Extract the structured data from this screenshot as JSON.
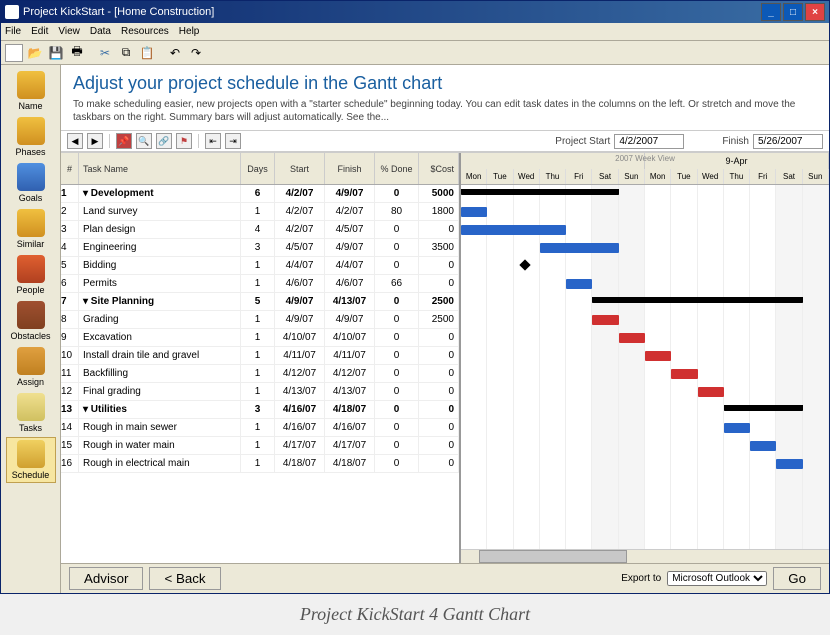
{
  "window": {
    "title": "Project KickStart - [Home Construction]"
  },
  "menu": [
    "File",
    "Edit",
    "View",
    "Data",
    "Resources",
    "Help"
  ],
  "sidebar": [
    "Name",
    "Phases",
    "Goals",
    "Similar",
    "People",
    "Obstacles",
    "Assign",
    "Tasks",
    "Schedule"
  ],
  "page": {
    "heading": "Adjust your project schedule in the Gantt chart",
    "description": "To make scheduling easier, new projects open with a \"starter schedule\" beginning today. You can edit task dates in the columns on the left. Or stretch and move the taskbars on the right. Summary bars will adjust automatically. See the..."
  },
  "gantt": {
    "start_label": "Project Start",
    "start_date": "4/2/2007",
    "finish_label": "Finish",
    "finish_date": "5/26/2007",
    "zoom": "2007 Week View"
  },
  "columns": [
    "#",
    "Task Name",
    "Days",
    "Start",
    "Finish",
    "% Done",
    "$Cost"
  ],
  "timeline": {
    "weeks": [
      "9-Apr"
    ],
    "days": [
      "Mon",
      "Tue",
      "Wed",
      "Thu",
      "Fri",
      "Sat",
      "Sun",
      "Mon",
      "Tue",
      "Wed",
      "Thu",
      "Fri",
      "Sat",
      "Sun"
    ]
  },
  "tasks": [
    {
      "id": 1,
      "name": "Development",
      "days": 6,
      "start": "4/2/07",
      "finish": "4/9/07",
      "done": 0,
      "cost": 5000,
      "summary": true,
      "indent": 0,
      "bar": [
        0,
        6
      ],
      "type": "summary"
    },
    {
      "id": 2,
      "name": "Land survey",
      "days": 1,
      "start": "4/2/07",
      "finish": "4/2/07",
      "done": 80,
      "cost": 1800,
      "indent": 1,
      "bar": [
        0,
        1
      ],
      "type": "task"
    },
    {
      "id": 3,
      "name": "Plan design",
      "days": 4,
      "start": "4/2/07",
      "finish": "4/5/07",
      "done": 0,
      "cost": 0,
      "indent": 1,
      "bar": [
        0,
        4
      ],
      "type": "task"
    },
    {
      "id": 4,
      "name": "Engineering",
      "days": 3,
      "start": "4/5/07",
      "finish": "4/9/07",
      "done": 0,
      "cost": 3500,
      "indent": 1,
      "bar": [
        3,
        3
      ],
      "type": "task"
    },
    {
      "id": 5,
      "name": "Bidding",
      "days": 1,
      "start": "4/4/07",
      "finish": "4/4/07",
      "done": 0,
      "cost": 0,
      "indent": 1,
      "bar": [
        2,
        0
      ],
      "type": "milestone"
    },
    {
      "id": 6,
      "name": "Permits",
      "days": 1,
      "start": "4/6/07",
      "finish": "4/6/07",
      "done": 66,
      "cost": 0,
      "indent": 1,
      "bar": [
        4,
        1
      ],
      "type": "task"
    },
    {
      "id": 7,
      "name": "Site Planning",
      "days": 5,
      "start": "4/9/07",
      "finish": "4/13/07",
      "done": 0,
      "cost": 2500,
      "summary": true,
      "indent": 0,
      "bar": [
        5,
        8
      ],
      "type": "summary"
    },
    {
      "id": 8,
      "name": "Grading",
      "days": 1,
      "start": "4/9/07",
      "finish": "4/9/07",
      "done": 0,
      "cost": 2500,
      "indent": 1,
      "bar": [
        5,
        1
      ],
      "type": "red"
    },
    {
      "id": 9,
      "name": "Excavation",
      "days": 1,
      "start": "4/10/07",
      "finish": "4/10/07",
      "done": 0,
      "cost": 0,
      "indent": 1,
      "bar": [
        6,
        1
      ],
      "type": "red"
    },
    {
      "id": 10,
      "name": "Install drain tile and gravel",
      "days": 1,
      "start": "4/11/07",
      "finish": "4/11/07",
      "done": 0,
      "cost": 0,
      "indent": 1,
      "bar": [
        7,
        1
      ],
      "type": "red"
    },
    {
      "id": 11,
      "name": "Backfilling",
      "days": 1,
      "start": "4/12/07",
      "finish": "4/12/07",
      "done": 0,
      "cost": 0,
      "indent": 1,
      "bar": [
        8,
        1
      ],
      "type": "red"
    },
    {
      "id": 12,
      "name": "Final grading",
      "days": 1,
      "start": "4/13/07",
      "finish": "4/13/07",
      "done": 0,
      "cost": 0,
      "indent": 1,
      "bar": [
        9,
        1
      ],
      "type": "red"
    },
    {
      "id": 13,
      "name": "Utilities",
      "days": 3,
      "start": "4/16/07",
      "finish": "4/18/07",
      "done": 0,
      "cost": 0,
      "summary": true,
      "indent": 0,
      "bar": [
        10,
        3
      ],
      "type": "summary"
    },
    {
      "id": 14,
      "name": "Rough in main sewer",
      "days": 1,
      "start": "4/16/07",
      "finish": "4/16/07",
      "done": 0,
      "cost": 0,
      "indent": 1,
      "bar": [
        10,
        1
      ],
      "type": "task"
    },
    {
      "id": 15,
      "name": "Rough in water main",
      "days": 1,
      "start": "4/17/07",
      "finish": "4/17/07",
      "done": 0,
      "cost": 0,
      "indent": 1,
      "bar": [
        11,
        1
      ],
      "type": "task"
    },
    {
      "id": 16,
      "name": "Rough in electrical main",
      "days": 1,
      "start": "4/18/07",
      "finish": "4/18/07",
      "done": 0,
      "cost": 0,
      "indent": 1,
      "bar": [
        12,
        1
      ],
      "type": "task"
    }
  ],
  "footer": {
    "advisor": "Advisor",
    "back": "< Back",
    "export_label": "Export to",
    "export_value": "Microsoft Outlook",
    "go": "Go"
  },
  "caption": "Project KickStart 4 Gantt Chart",
  "chart_data": {
    "type": "gantt",
    "title": "Home Construction Schedule",
    "start_date": "4/2/2007",
    "finish_date": "5/26/2007",
    "x_unit": "days from 4/2/2007",
    "tasks": [
      {
        "id": 1,
        "name": "Development",
        "start": 0,
        "duration": 6,
        "type": "summary",
        "pct": 0,
        "cost": 5000
      },
      {
        "id": 2,
        "name": "Land survey",
        "start": 0,
        "duration": 1,
        "type": "task",
        "pct": 80,
        "cost": 1800
      },
      {
        "id": 3,
        "name": "Plan design",
        "start": 0,
        "duration": 4,
        "type": "task",
        "pct": 0,
        "cost": 0
      },
      {
        "id": 4,
        "name": "Engineering",
        "start": 3,
        "duration": 3,
        "type": "task",
        "pct": 0,
        "cost": 3500
      },
      {
        "id": 5,
        "name": "Bidding",
        "start": 2,
        "duration": 0,
        "type": "milestone",
        "pct": 0,
        "cost": 0
      },
      {
        "id": 6,
        "name": "Permits",
        "start": 4,
        "duration": 1,
        "type": "task",
        "pct": 66,
        "cost": 0
      },
      {
        "id": 7,
        "name": "Site Planning",
        "start": 5,
        "duration": 5,
        "type": "summary",
        "pct": 0,
        "cost": 2500
      },
      {
        "id": 8,
        "name": "Grading",
        "start": 5,
        "duration": 1,
        "type": "task",
        "pct": 0,
        "cost": 2500
      },
      {
        "id": 9,
        "name": "Excavation",
        "start": 6,
        "duration": 1,
        "type": "task",
        "pct": 0,
        "cost": 0
      },
      {
        "id": 10,
        "name": "Install drain tile and gravel",
        "start": 7,
        "duration": 1,
        "type": "task",
        "pct": 0,
        "cost": 0
      },
      {
        "id": 11,
        "name": "Backfilling",
        "start": 8,
        "duration": 1,
        "type": "task",
        "pct": 0,
        "cost": 0
      },
      {
        "id": 12,
        "name": "Final grading",
        "start": 9,
        "duration": 1,
        "type": "task",
        "pct": 0,
        "cost": 0
      },
      {
        "id": 13,
        "name": "Utilities",
        "start": 10,
        "duration": 3,
        "type": "summary",
        "pct": 0,
        "cost": 0
      },
      {
        "id": 14,
        "name": "Rough in main sewer",
        "start": 10,
        "duration": 1,
        "type": "task",
        "pct": 0,
        "cost": 0
      },
      {
        "id": 15,
        "name": "Rough in water main",
        "start": 11,
        "duration": 1,
        "type": "task",
        "pct": 0,
        "cost": 0
      },
      {
        "id": 16,
        "name": "Rough in electrical main",
        "start": 12,
        "duration": 1,
        "type": "task",
        "pct": 0,
        "cost": 0
      }
    ]
  }
}
